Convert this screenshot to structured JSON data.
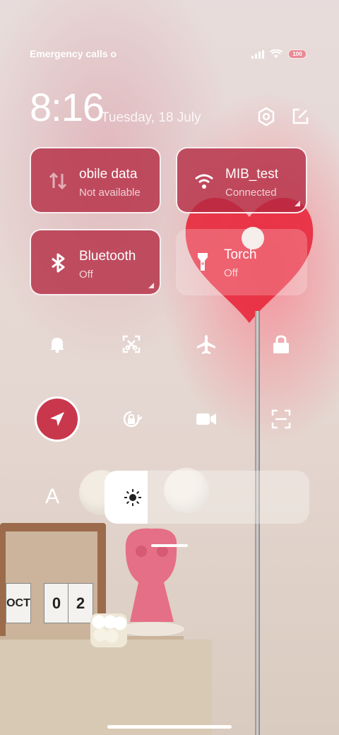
{
  "status_bar": {
    "carrier_text": "Emergency calls o",
    "battery": "100",
    "icons": [
      "signal-icon",
      "wifi-icon",
      "battery-icon"
    ]
  },
  "header": {
    "time": "8:16",
    "date": "Tuesday, 18 July",
    "buttons": [
      "settings-icon",
      "edit-icon"
    ]
  },
  "tiles": [
    {
      "id": "mobile-data",
      "label": "obile data",
      "sub": "Not available",
      "icon": "mobile-data-icon",
      "state": "on"
    },
    {
      "id": "wifi",
      "label": "MIB_test",
      "sub": "Connected",
      "icon": "wifi-icon",
      "state": "on"
    },
    {
      "id": "bluetooth",
      "label": "Bluetooth",
      "sub": "Off",
      "icon": "bluetooth-icon",
      "state": "on"
    },
    {
      "id": "torch",
      "label": "Torch",
      "sub": "Off",
      "icon": "torch-icon",
      "state": "off"
    }
  ],
  "toggles_row1": [
    "bell-icon",
    "screenshot-cross-icon",
    "airplane-icon",
    "lock-icon"
  ],
  "toggles_row2": [
    "location-icon",
    "rotation-lock-icon",
    "video-camera-icon",
    "scan-icon"
  ],
  "brightness": {
    "auto_label": "A",
    "level": 0.21
  },
  "colors": {
    "accent": "#c9374d",
    "tile_on": "#b42840"
  }
}
